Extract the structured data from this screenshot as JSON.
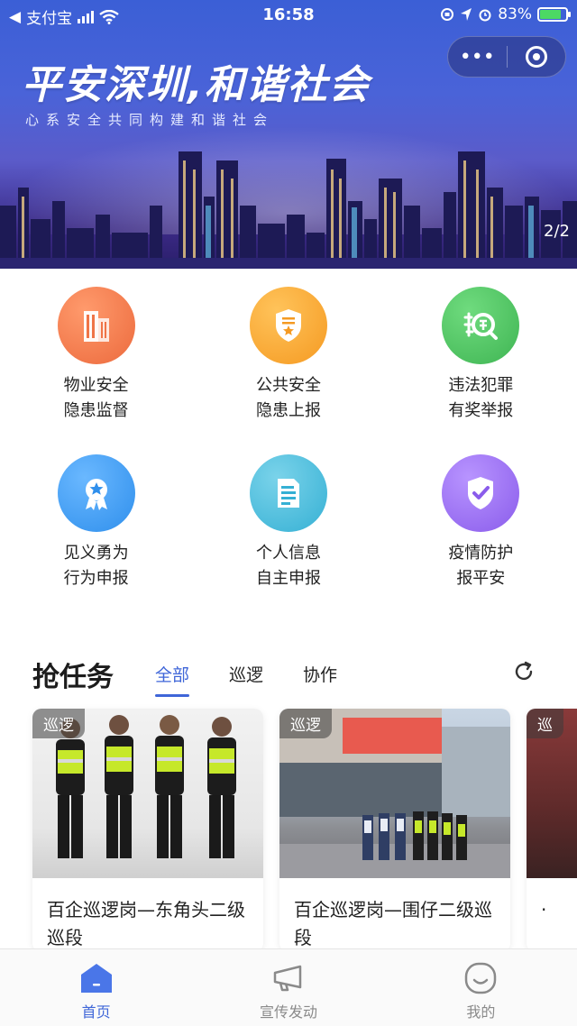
{
  "status_bar": {
    "back_app": "支付宝",
    "time": "16:58",
    "battery": "83%"
  },
  "banner": {
    "title": "平安深圳,和谐社会",
    "subtitle": "心系安全共同构建和谐社会",
    "pager": "2/2"
  },
  "services": [
    {
      "line1": "物业安全",
      "line2": "隐患监督",
      "icon": "building-icon",
      "color": "#ef7447"
    },
    {
      "line1": "公共安全",
      "line2": "隐患上报",
      "icon": "shield-star-icon",
      "color": "#f7a531"
    },
    {
      "line1": "违法犯罪",
      "line2": "有奖举报",
      "icon": "report-search-icon",
      "color": "#4cc460"
    },
    {
      "line1": "见义勇为",
      "line2": "行为申报",
      "icon": "medal-icon",
      "color": "#3f9cf0"
    },
    {
      "line1": "个人信息",
      "line2": "自主申报",
      "icon": "document-icon",
      "color": "#40b9d9"
    },
    {
      "line1": "疫情防护",
      "line2": "报平安",
      "icon": "shield-check-icon",
      "color": "#9b6ff0"
    }
  ],
  "tasks": {
    "title": "抢任务",
    "tabs": [
      "全部",
      "巡逻",
      "协作"
    ],
    "cards": [
      {
        "tag": "巡逻",
        "title": "百企巡逻岗—东角头二级巡段"
      },
      {
        "tag": "巡逻",
        "title": "百企巡逻岗—围仔二级巡段"
      },
      {
        "tag": "巡",
        "title": "·"
      }
    ]
  },
  "tabbar": [
    {
      "label": "首页",
      "icon": "home-icon"
    },
    {
      "label": "宣传发动",
      "icon": "megaphone-icon"
    },
    {
      "label": "我的",
      "icon": "profile-icon"
    }
  ]
}
